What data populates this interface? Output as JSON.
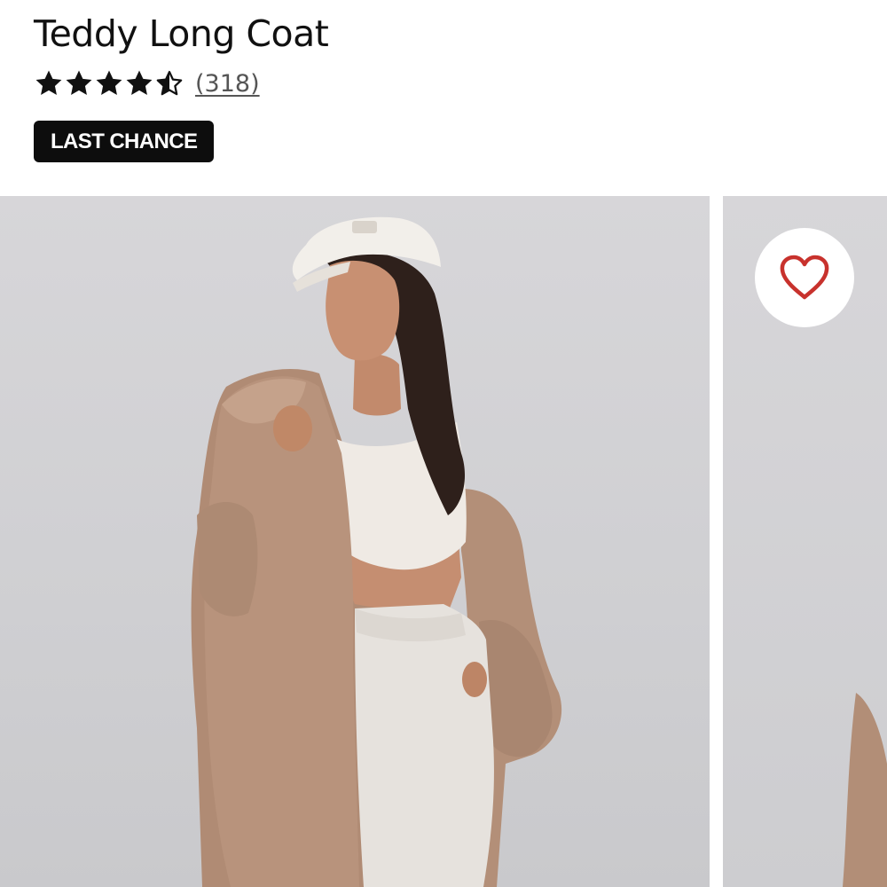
{
  "product": {
    "title": "Teddy Long Coat",
    "rating": 4.5,
    "rating_max": 5,
    "review_count": "(318)",
    "badge": "LAST CHANCE"
  },
  "gallery": {
    "main_image": "model-wearing-teddy-long-coat",
    "next_image": "teddy-long-coat-partial",
    "favorite_icon": "heart-outline-icon"
  },
  "colors": {
    "text_primary": "#111111",
    "badge_bg": "#0d0d0d",
    "badge_text": "#ffffff",
    "heart": "#c8322d",
    "photo_bg": "#d3d3d6",
    "coat": "#b5917a"
  }
}
